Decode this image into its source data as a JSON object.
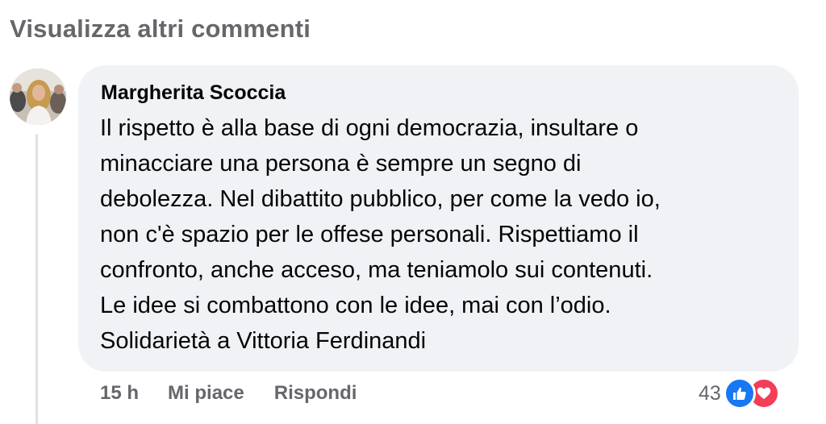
{
  "header": {
    "view_more_label": "Visualizza altri commenti"
  },
  "comment": {
    "author": "Margherita Scoccia",
    "lines": [
      "Il rispetto è alla base di ogni democrazia, insultare o",
      "minacciare una persona è sempre un segno di",
      "debolezza. Nel dibattito pubblico, per come la vedo io,",
      "non c'è spazio per le offese personali. Rispettiamo il",
      "confronto, anche acceso, ma teniamolo sui contenuti.",
      "Le idee si combattono con le idee, mai con l’odio.",
      "Solidarietà a Vittoria Ferdinandi"
    ],
    "timestamp": "15 h",
    "like_label": "Mi piace",
    "reply_label": "Rispondi",
    "reaction_count": "43",
    "reactions": [
      "like-icon",
      "love-icon"
    ]
  },
  "colors": {
    "bubble": "#f0f2f5",
    "secondary_text": "#65676b",
    "like_blue": "#1877f2",
    "love_red": "#f33e58"
  }
}
